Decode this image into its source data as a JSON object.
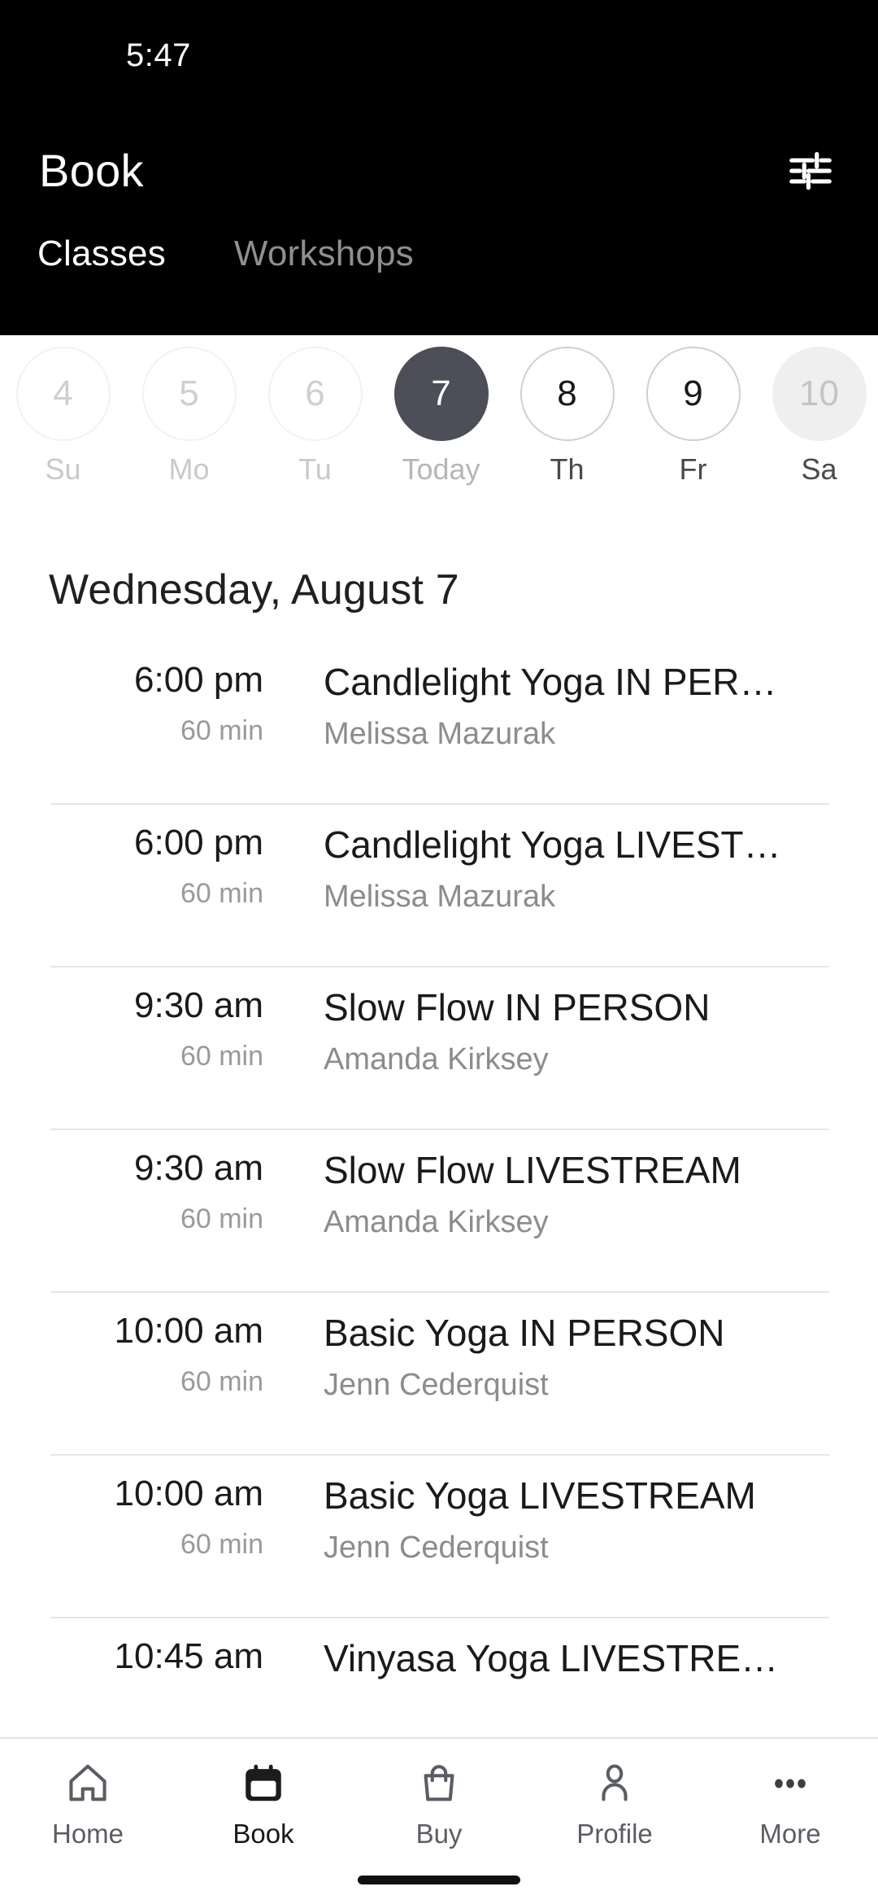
{
  "status_bar": {
    "time": "5:47"
  },
  "header": {
    "title": "Book",
    "filter_icon": "sliders-filter-icon",
    "tabs": [
      {
        "label": "Classes",
        "active": true
      },
      {
        "label": "Workshops",
        "active": false
      }
    ]
  },
  "date_strip": {
    "days": [
      {
        "number": "4",
        "weekday": "Su",
        "state": "disabled"
      },
      {
        "number": "5",
        "weekday": "Mo",
        "state": "disabled"
      },
      {
        "number": "6",
        "weekday": "Tu",
        "state": "disabled"
      },
      {
        "number": "7",
        "weekday": "Today",
        "state": "selected"
      },
      {
        "number": "8",
        "weekday": "Th",
        "state": "normal"
      },
      {
        "number": "9",
        "weekday": "Fr",
        "state": "normal"
      },
      {
        "number": "10",
        "weekday": "Sa",
        "state": "shaded"
      }
    ]
  },
  "day_heading": "Wednesday, August 7",
  "classes": [
    {
      "time": "6:00 pm",
      "duration": "60 min",
      "name": "Candlelight Yoga IN PER…",
      "teacher": "Melissa Mazurak"
    },
    {
      "time": "6:00 pm",
      "duration": "60 min",
      "name": "Candlelight Yoga LIVEST…",
      "teacher": "Melissa Mazurak"
    },
    {
      "time": "9:30 am",
      "duration": "60 min",
      "name": "Slow Flow IN PERSON",
      "teacher": "Amanda Kirksey"
    },
    {
      "time": "9:30 am",
      "duration": "60 min",
      "name": "Slow Flow LIVESTREAM",
      "teacher": "Amanda Kirksey"
    },
    {
      "time": "10:00 am",
      "duration": "60 min",
      "name": "Basic Yoga IN PERSON",
      "teacher": "Jenn Cederquist"
    },
    {
      "time": "10:00 am",
      "duration": "60 min",
      "name": "Basic Yoga LIVESTREAM",
      "teacher": "Jenn Cederquist"
    },
    {
      "time": "10:45 am",
      "duration": "",
      "name": "Vinyasa Yoga LIVESTRE…",
      "teacher": ""
    }
  ],
  "bottom_nav": {
    "items": [
      {
        "label": "Home",
        "icon": "home-icon",
        "active": false
      },
      {
        "label": "Book",
        "icon": "calendar-icon",
        "active": true
      },
      {
        "label": "Buy",
        "icon": "bag-icon",
        "active": false
      },
      {
        "label": "Profile",
        "icon": "person-icon",
        "active": false
      },
      {
        "label": "More",
        "icon": "ellipsis-icon",
        "active": false
      }
    ]
  },
  "colors": {
    "header_bg": "#000000",
    "selected_day": "#4c4f58",
    "page_bg": "#ffffff",
    "muted_text": "#8c8c8c",
    "divider": "#e6e6e6"
  }
}
